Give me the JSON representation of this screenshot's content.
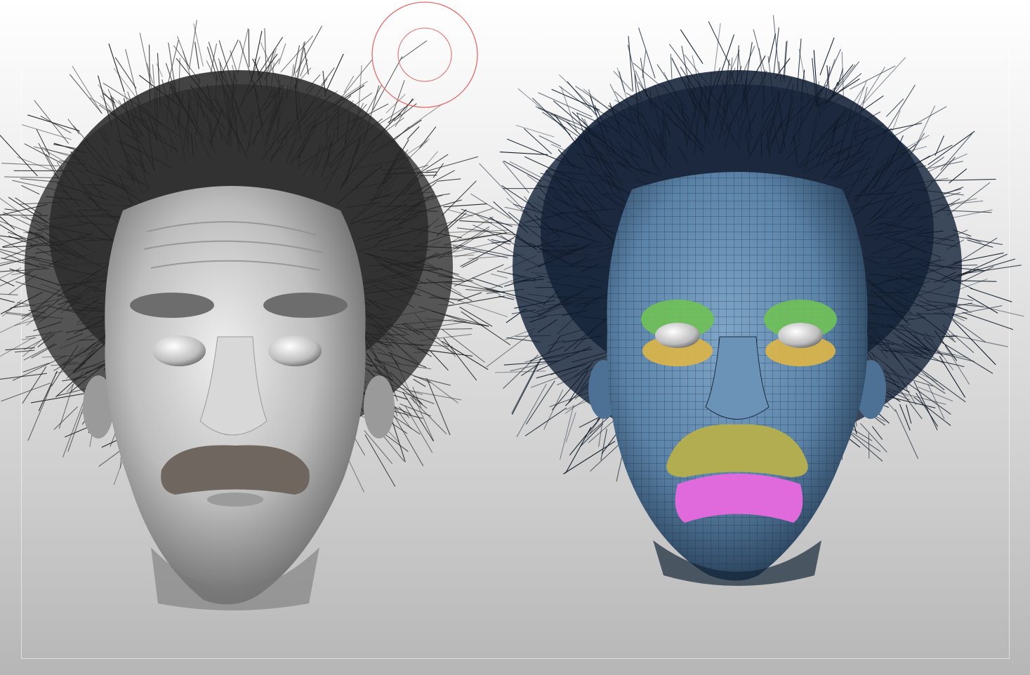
{
  "canvas": {
    "background_top": "#ffffff",
    "background_bottom": "#b6b6b6"
  },
  "models": [
    {
      "name": "sculpt-head-shaded",
      "skin_color": "#cfcfcf",
      "hair_color": "#2f2f2f",
      "mustache_color": "#6e665f"
    },
    {
      "name": "sculpt-head-polygroups",
      "skin_color": "#5d87ad",
      "hair_color": "#17253a",
      "mustache_color": "#b3ad52",
      "eyebrow_polygroup_color": "#6fbf5a",
      "eyelid_polygroup_color": "#d8b34c",
      "lip_polygroup_color": "#e06adc"
    }
  ],
  "brush_cursor": {
    "color": "#e86a6a"
  }
}
